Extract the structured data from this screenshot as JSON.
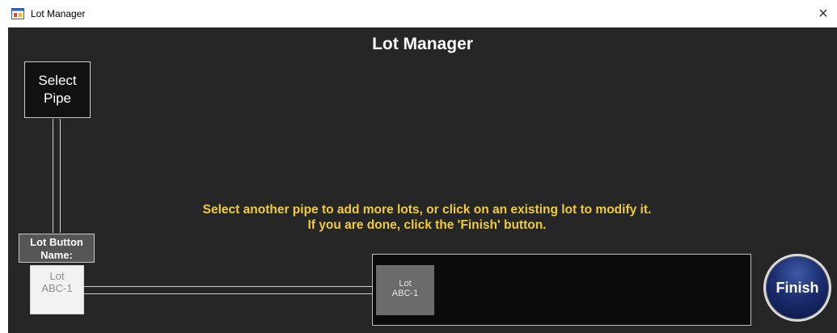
{
  "window": {
    "title": "Lot Manager",
    "close_glyph": "×"
  },
  "main": {
    "heading": "Lot Manager",
    "select_pipe_line1": "Select",
    "select_pipe_line2": "Pipe",
    "lot_button_name_line1": "Lot Button",
    "lot_button_name_line2": "Name:",
    "preview_lot_line1": "Lot",
    "preview_lot_line2": "ABC-1",
    "message_line1": "Select another pipe to add more lots, or click on an existing lot to modify it.",
    "message_line2": "If you are done, click the 'Finish' button.",
    "lots": [
      {
        "line1": "Lot",
        "line2": "ABC-1"
      }
    ],
    "finish_label": "Finish"
  },
  "colors": {
    "background": "#262626",
    "message": "#f0cc36",
    "finish": "#1b2d6e"
  },
  "icons": {
    "app": "application-window-icon",
    "close": "close-icon"
  }
}
